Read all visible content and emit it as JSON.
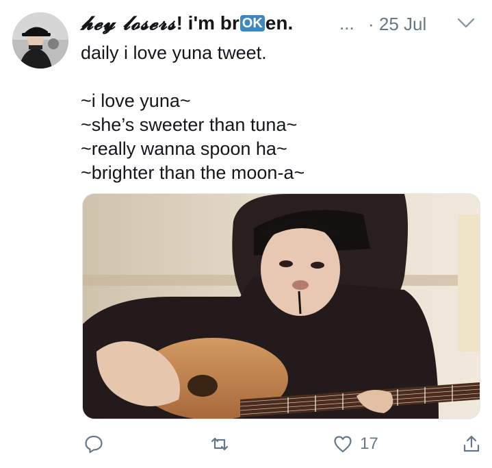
{
  "author": {
    "display_name_fancy": "𝓱𝓮𝔂 𝓵𝓸𝓼𝓮𝓻𝓼",
    "display_name_mid": "! i'm br",
    "display_name_badge": "OK",
    "display_name_end": "en.",
    "truncation": "...",
    "date": "· 25 Jul"
  },
  "tweet": {
    "lines": [
      "daily i love yuna tweet.",
      "",
      "~i love yuna~",
      "~she’s sweeter than tuna~",
      "~really wanna spoon ha~",
      "~brighter than the moon-a~"
    ]
  },
  "actions": {
    "reply_count": "",
    "retweet_count": "",
    "like_count": "17"
  },
  "icons": {
    "reply": "reply-icon",
    "retweet": "retweet-icon",
    "like": "heart-icon",
    "share": "share-icon",
    "menu": "chevron-down-icon"
  },
  "colors": {
    "text": "#14171a",
    "secondary": "#657786",
    "badge": "#3b88c3"
  }
}
